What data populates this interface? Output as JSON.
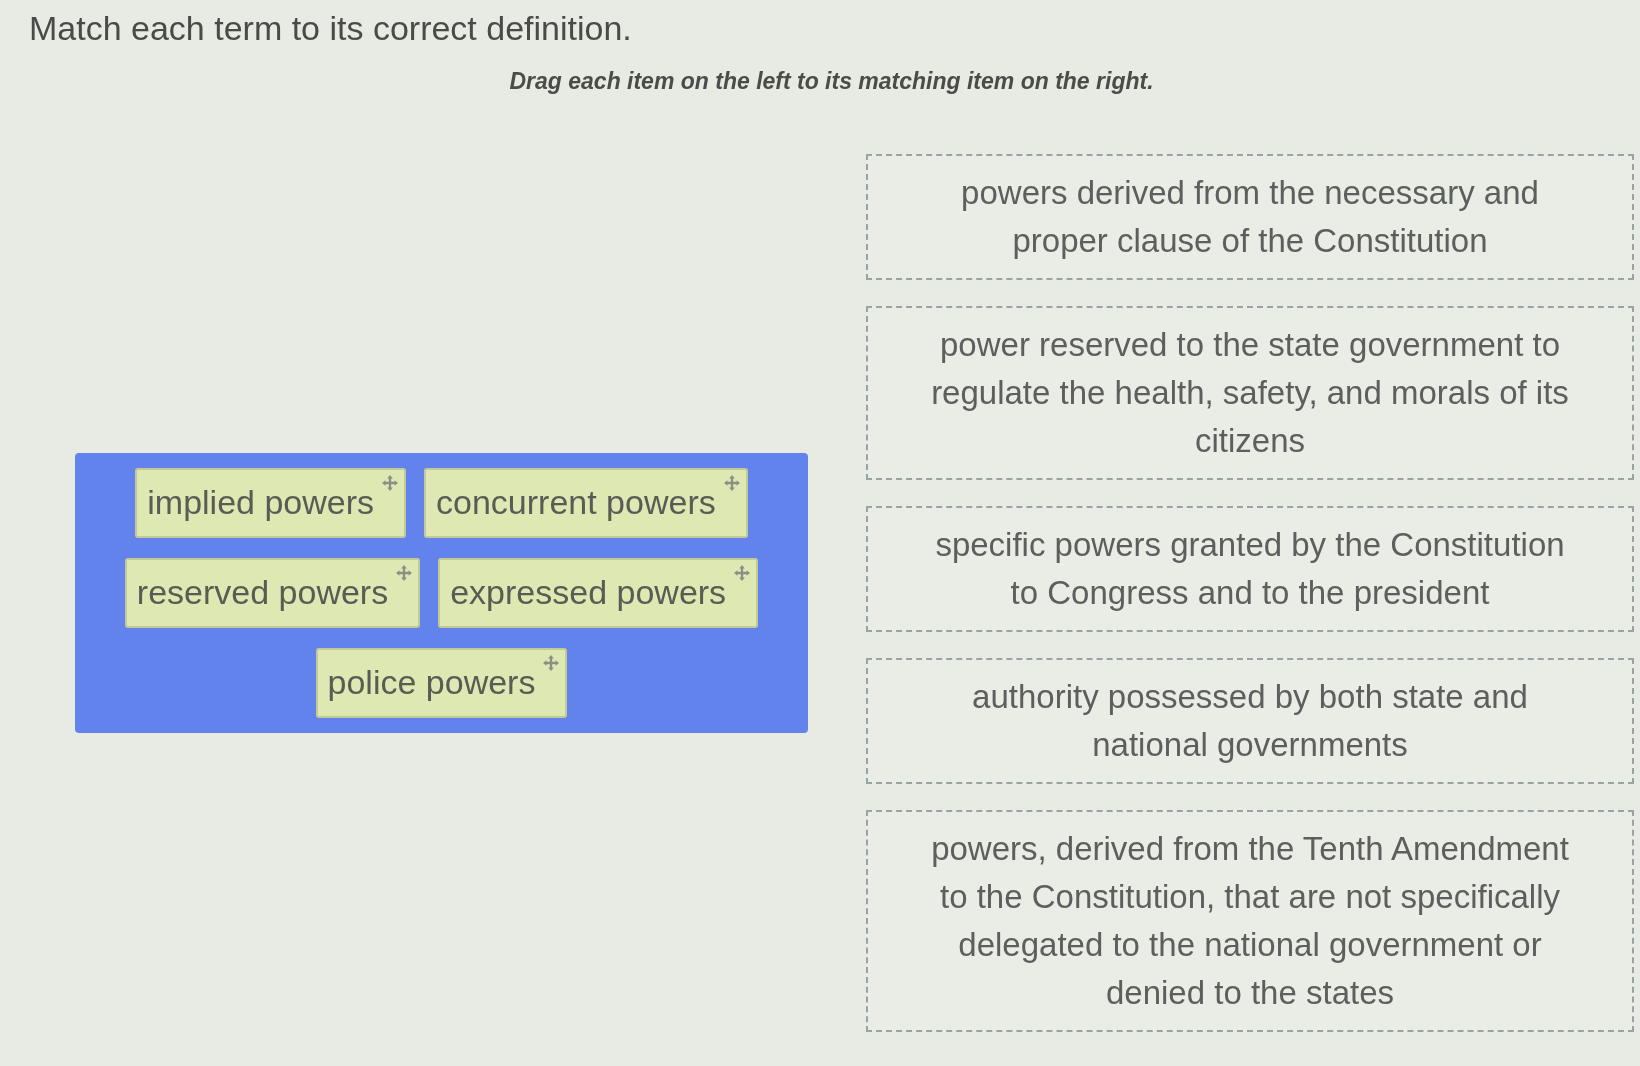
{
  "question": {
    "title": "Match each term to its correct definition.",
    "instruction": "Drag each item on the left to its matching item on the right."
  },
  "terms": [
    {
      "label": "implied powers"
    },
    {
      "label": "concurrent powers"
    },
    {
      "label": "reserved powers"
    },
    {
      "label": "expressed powers"
    },
    {
      "label": "police powers"
    }
  ],
  "definitions": [
    {
      "text": "powers derived from the necessary and proper clause of the Constitution"
    },
    {
      "text": "power reserved to the state government to regulate the health, safety, and morals of its citizens"
    },
    {
      "text": "specific powers granted by the Constitution to Congress and to the president"
    },
    {
      "text": "authority possessed by both state and national governments"
    },
    {
      "text": "powers, derived from the Tenth Amendment to the Constitution, that are not specifically delegated to the national government or denied to the states"
    }
  ]
}
